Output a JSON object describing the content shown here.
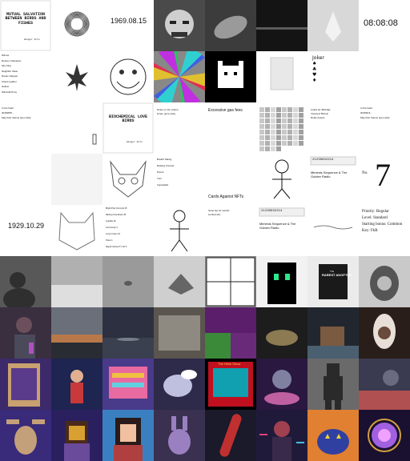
{
  "tiles": [
    {
      "kind": "doc-title",
      "title": "MUTUAL SALVATION BETWEEN BIRDS AND FISHES",
      "author": "Ginger Arts"
    },
    {
      "kind": "scribble"
    },
    {
      "kind": "date",
      "text": "1969.08.15"
    },
    {
      "kind": "photo",
      "bg": "#4a4a4a",
      "fg": "#cfcfcf",
      "shape": "face"
    },
    {
      "kind": "photo",
      "bg": "#3c3c3c",
      "fg": "#9a9a9a",
      "shape": "trinket"
    },
    {
      "kind": "photo",
      "bg": "#141414",
      "fg": "#5c5c5c",
      "shape": "horizon"
    },
    {
      "kind": "photo",
      "bg": "#d8d8d8",
      "fg": "#f2f2f2",
      "shape": "crystal"
    },
    {
      "kind": "clock",
      "text": "08:08:08"
    },
    {
      "kind": "list",
      "lines": [
        "Winner",
        "Runner Champion",
        "Sky King",
        "Neighbor Taste",
        "Dream Stepper",
        "Cloud Leather",
        "Hollow",
        "Windmill Pony"
      ]
    },
    {
      "kind": "leaf"
    },
    {
      "kind": "trollface"
    },
    {
      "kind": "swirl"
    },
    {
      "kind": "pixelcat"
    },
    {
      "kind": "panel"
    },
    {
      "kind": "cards",
      "lines": [
        "Joker",
        "♠",
        "♣",
        "♥",
        "♦"
      ]
    },
    {
      "kind": "blank"
    },
    {
      "kind": "hash",
      "lines": [
        "In the hash:",
        "3b4f0258…",
        "May their tokens open wide"
      ]
    },
    {
      "kind": "bracket"
    },
    {
      "kind": "doc-title",
      "title": "BIOCHEMICAL LOVE BIRDS",
      "author": "Ginger Arts"
    },
    {
      "kind": "note",
      "lines": [
        "Notes on the scarce",
        "loved, gone lucky"
      ]
    },
    {
      "kind": "gas",
      "text": "Excessive gas fees"
    },
    {
      "kind": "noise"
    },
    {
      "kind": "note",
      "lines": [
        "Listed as: Birthday",
        "Invented: Bitcoin",
        "Dokie Assets"
      ]
    },
    {
      "kind": "hash",
      "lines": [
        "In the hash:",
        "3b4f02c3…",
        "May their tokens open wide"
      ]
    },
    {
      "kind": "blank"
    },
    {
      "kind": "dotted"
    },
    {
      "kind": "pixelskull"
    },
    {
      "kind": "stats",
      "lines": [
        "Breath Taking",
        "Raising Counter",
        "Points",
        "Turn",
        "Impossible"
      ]
    },
    {
      "kind": "cah",
      "text": "Cards Against NFTs"
    },
    {
      "kind": "stick"
    },
    {
      "kind": "monogame",
      "text": "21230932214",
      "lines": [
        "Mimesis Sequence & The",
        "Golden Radio"
      ]
    },
    {
      "kind": "bignum",
      "text": "7",
      "small": "No."
    },
    {
      "kind": "date",
      "text": "1929.10.29"
    },
    {
      "kind": "pixelcat2"
    },
    {
      "kind": "stats2",
      "lines": [
        "Bright Pool (Current) 45",
        "Raising Countdown 46",
        "Liquidity 52",
        "Community 4",
        "Lucent Index 43",
        "Ticket 1",
        "Signal Camera Tv Vol 5"
      ]
    },
    {
      "kind": "stick2"
    },
    {
      "kind": "receipt",
      "lines": [
        "Issue fee for sender",
        "Limited slot"
      ]
    },
    {
      "kind": "golden",
      "text": "21230932214",
      "lines": [
        "Mimesis Sequence & The",
        "Golden Radio"
      ]
    },
    {
      "kind": "scrawl"
    },
    {
      "kind": "priority",
      "lines": [
        "Priority: Regular",
        "Level: Standard",
        "Starting bonus: Common",
        "Key: FkB"
      ]
    },
    {
      "kind": "photo",
      "bg": "#585858",
      "fg": "#2f2f2f",
      "shape": "person"
    },
    {
      "kind": "photo",
      "bg": "#b0b0b0",
      "fg": "#dedede",
      "shape": "fog"
    },
    {
      "kind": "photo",
      "bg": "#9a9a9a",
      "fg": "#5a5a5a",
      "shape": "balloon"
    },
    {
      "kind": "photo",
      "bg": "#cfcfcf",
      "fg": "#666666",
      "shape": "fabric"
    },
    {
      "kind": "comic"
    },
    {
      "kind": "pixelalien"
    },
    {
      "kind": "book",
      "text": "RAREST ADOPTER",
      "top": "The"
    },
    {
      "kind": "photo",
      "bg": "#c9c9c9",
      "fg": "#555555",
      "shape": "hood"
    },
    {
      "kind": "photo",
      "bg": "#3a2f3f",
      "fg": "#6b4f5a",
      "shape": "soldier"
    },
    {
      "kind": "photo",
      "bg": "#6a6f7a",
      "fg": "#b8784a",
      "shape": "sunset"
    },
    {
      "kind": "photo",
      "bg": "#2c3040",
      "fg": "#7a7d8a",
      "shape": "sea"
    },
    {
      "kind": "photo",
      "bg": "#5a554e",
      "fg": "#8e8a82",
      "shape": "canvas"
    },
    {
      "kind": "purple"
    },
    {
      "kind": "photo",
      "bg": "#1d1d1d",
      "fg": "#8b7a52",
      "shape": "rock"
    },
    {
      "kind": "photo",
      "bg": "#22272f",
      "fg": "#7a5a40",
      "shape": "house"
    },
    {
      "kind": "photo",
      "bg": "#2a1e1a",
      "fg": "#e8e0d8",
      "shape": "goddess"
    },
    {
      "kind": "photo",
      "bg": "#3c2a6a",
      "fg": "#c9a070",
      "shape": "poster"
    },
    {
      "kind": "photo",
      "bg": "#1d2550",
      "fg": "#c83a3a",
      "shape": "warrior"
    },
    {
      "kind": "photo",
      "bg": "#4a3a8a",
      "fg": "#e86aa0",
      "shape": "retro"
    },
    {
      "kind": "photo",
      "bg": "#2e2a4a",
      "fg": "#bfbfdf",
      "shape": "balloon2"
    },
    {
      "kind": "tv",
      "text": "The Hello Show"
    },
    {
      "kind": "photo",
      "bg": "#2a1840",
      "fg": "#c060a0",
      "shape": "robot"
    },
    {
      "kind": "photo",
      "bg": "#6a6a6a",
      "fg": "#2a2a2a",
      "shape": "silhouette"
    },
    {
      "kind": "photo",
      "bg": "#3a3a50",
      "fg": "#b05050",
      "shape": "dark"
    },
    {
      "kind": "photo",
      "bg": "#3a2a7a",
      "fg": "#c4a07a",
      "shape": "moose"
    },
    {
      "kind": "photo",
      "bg": "#2a2060",
      "fg": "#d8a030",
      "shape": "pixelguy"
    },
    {
      "kind": "photo",
      "bg": "#3a80c0",
      "fg": "#b04040",
      "shape": "pixelgirl"
    },
    {
      "kind": "photo",
      "bg": "#3a3050",
      "fg": "#9a80c0",
      "shape": "bunny"
    },
    {
      "kind": "photo",
      "bg": "#1a1a2a",
      "fg": "#c03030",
      "shape": "skate"
    },
    {
      "kind": "photo",
      "bg": "#201a3a",
      "fg": "#e04080",
      "shape": "cyber"
    },
    {
      "kind": "photo",
      "bg": "#e08030",
      "fg": "#3040a0",
      "shape": "pumpkin"
    },
    {
      "kind": "photo",
      "bg": "#1a1030",
      "fg": "#a060e0",
      "shape": "orb"
    }
  ]
}
